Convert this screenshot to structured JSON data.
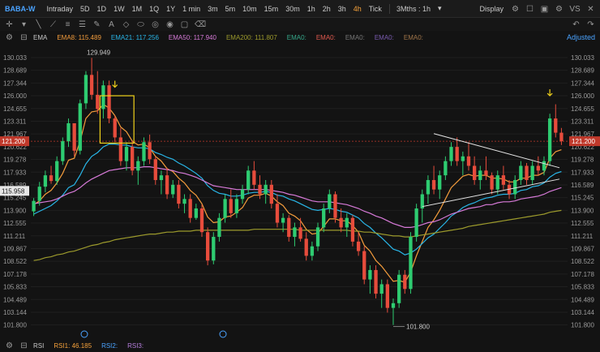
{
  "toolbar": {
    "symbol": "BABA-W",
    "timeframes": [
      "Intraday",
      "5D",
      "1D",
      "1W",
      "1M",
      "1Q",
      "1Y",
      "1 min",
      "3m",
      "5m",
      "10m",
      "15m",
      "30m",
      "1h",
      "2h",
      "3h",
      "4h",
      "Tick"
    ],
    "active_timeframe": "4h",
    "range": "3Mths : 1h",
    "display": "Display",
    "right_label": "VS"
  },
  "indicators": {
    "type": "EMA",
    "items": [
      {
        "label": "EMA8:",
        "value": "115.489",
        "color": "#f39c3c"
      },
      {
        "label": "EMA21:",
        "value": "117.256",
        "color": "#29b6e8"
      },
      {
        "label": "EMA50:",
        "value": "117.940",
        "color": "#d77ad8"
      },
      {
        "label": "EMA200:",
        "value": "111.807",
        "color": "#9c9a2c"
      },
      {
        "label": "EMA0:",
        "value": "",
        "color": "#36a88a"
      },
      {
        "label": "EMA0:",
        "value": "",
        "color": "#e25a4f"
      },
      {
        "label": "EMA0:",
        "value": "",
        "color": "#777777"
      },
      {
        "label": "EMA0:",
        "value": "",
        "color": "#7a5bb0"
      },
      {
        "label": "EMA0:",
        "value": "",
        "color": "#a0754a"
      }
    ],
    "adjusted": "Adjusted"
  },
  "rsi": {
    "type": "RSI",
    "items": [
      {
        "label": "RSI1:",
        "value": "46.185",
        "color": "#f6a23b"
      },
      {
        "label": "RSI2:",
        "value": "",
        "color": "#4aa3ff"
      },
      {
        "label": "RSI3:",
        "value": "",
        "color": "#b57edc"
      }
    ]
  },
  "chart_data": {
    "type": "line",
    "title": "",
    "y_ticks": [
      "130.033",
      "128.689",
      "127.344",
      "126.000",
      "124.655",
      "123.311",
      "121.967",
      "120.622",
      "119.278",
      "117.933",
      "116.589",
      "115.245",
      "113.900",
      "112.555",
      "111.211",
      "109.867",
      "108.522",
      "107.178",
      "105.833",
      "104.489",
      "103.144",
      "101.800"
    ],
    "ylim": [
      101.0,
      130.8
    ],
    "current_price": "121.200",
    "last_close_label": "115.958",
    "annotations": [
      {
        "text": "129.949",
        "type": "high"
      },
      {
        "text": "101.800",
        "type": "low"
      }
    ],
    "candles": [
      [
        113.8,
        115.2,
        113.3,
        114.9
      ],
      [
        114.9,
        116.9,
        114.4,
        116.4
      ],
      [
        116.4,
        118.1,
        115.8,
        117.6
      ],
      [
        117.6,
        118.6,
        116.7,
        117.0
      ],
      [
        117.0,
        119.6,
        116.6,
        119.1
      ],
      [
        119.1,
        121.6,
        118.7,
        121.2
      ],
      [
        121.2,
        123.6,
        120.6,
        123.1
      ],
      [
        123.1,
        122.8,
        119.6,
        120.2
      ],
      [
        120.2,
        125.6,
        119.8,
        125.2
      ],
      [
        125.2,
        128.6,
        124.6,
        128.2
      ],
      [
        128.2,
        130.0,
        125.6,
        126.1
      ],
      [
        126.1,
        128.6,
        124.1,
        124.6
      ],
      [
        124.6,
        127.6,
        123.6,
        127.1
      ],
      [
        127.1,
        127.6,
        123.1,
        123.6
      ],
      [
        123.6,
        123.9,
        121.1,
        121.6
      ],
      [
        121.6,
        122.6,
        118.6,
        119.1
      ],
      [
        119.1,
        121.1,
        118.1,
        120.6
      ],
      [
        120.6,
        121.2,
        117.6,
        118.1
      ],
      [
        118.1,
        119.6,
        116.6,
        119.1
      ],
      [
        119.1,
        121.6,
        118.6,
        121.1
      ],
      [
        121.1,
        121.9,
        118.8,
        119.3
      ],
      [
        119.3,
        119.6,
        116.6,
        117.1
      ],
      [
        117.1,
        118.1,
        115.6,
        117.6
      ],
      [
        117.6,
        118.4,
        115.1,
        115.6
      ],
      [
        115.6,
        117.1,
        115.2,
        116.6
      ],
      [
        116.6,
        117.1,
        114.1,
        114.6
      ],
      [
        114.6,
        115.6,
        113.6,
        115.1
      ],
      [
        115.1,
        115.6,
        112.6,
        113.1
      ],
      [
        113.1,
        114.6,
        112.9,
        114.1
      ],
      [
        114.1,
        114.5,
        111.1,
        111.6
      ],
      [
        111.6,
        112.1,
        108.1,
        108.6
      ],
      [
        108.6,
        111.6,
        108.2,
        111.1
      ],
      [
        111.1,
        113.6,
        110.6,
        113.1
      ],
      [
        113.1,
        115.6,
        112.6,
        115.1
      ],
      [
        115.1,
        116.1,
        113.1,
        113.6
      ],
      [
        113.6,
        115.6,
        113.1,
        115.1
      ],
      [
        115.1,
        116.6,
        114.6,
        116.1
      ],
      [
        116.1,
        118.6,
        115.6,
        118.1
      ],
      [
        118.1,
        119.1,
        116.1,
        116.6
      ],
      [
        116.6,
        117.6,
        115.1,
        115.6
      ],
      [
        115.6,
        117.1,
        114.6,
        116.6
      ],
      [
        116.6,
        117.1,
        114.1,
        114.6
      ],
      [
        114.6,
        115.6,
        112.1,
        112.6
      ],
      [
        112.6,
        113.6,
        111.6,
        113.1
      ],
      [
        113.1,
        113.4,
        110.6,
        111.1
      ],
      [
        111.1,
        112.6,
        110.1,
        112.1
      ],
      [
        112.1,
        113.1,
        110.6,
        110.9
      ],
      [
        110.9,
        111.6,
        108.6,
        109.1
      ],
      [
        109.1,
        110.6,
        108.6,
        110.1
      ],
      [
        110.1,
        112.6,
        109.6,
        112.1
      ],
      [
        112.1,
        114.6,
        111.6,
        114.1
      ],
      [
        114.1,
        116.1,
        113.6,
        115.6
      ],
      [
        115.6,
        115.9,
        112.6,
        113.1
      ],
      [
        113.1,
        114.1,
        111.6,
        112.1
      ],
      [
        112.1,
        113.6,
        111.1,
        113.1
      ],
      [
        113.1,
        113.4,
        110.1,
        110.6
      ],
      [
        110.6,
        111.6,
        109.1,
        109.6
      ],
      [
        109.6,
        110.1,
        106.1,
        106.6
      ],
      [
        106.6,
        108.1,
        105.1,
        107.6
      ],
      [
        107.6,
        108.1,
        104.6,
        105.1
      ],
      [
        105.1,
        106.6,
        103.6,
        106.1
      ],
      [
        106.1,
        106.6,
        103.1,
        103.6
      ],
      [
        103.6,
        104.6,
        101.8,
        104.1
      ],
      [
        104.1,
        107.6,
        103.6,
        107.1
      ],
      [
        107.1,
        107.6,
        105.1,
        105.6
      ],
      [
        105.6,
        111.6,
        105.1,
        111.1
      ],
      [
        111.1,
        114.6,
        110.6,
        114.1
      ],
      [
        114.1,
        116.1,
        112.6,
        115.6
      ],
      [
        115.6,
        117.6,
        114.6,
        117.1
      ],
      [
        117.1,
        118.6,
        115.6,
        116.1
      ],
      [
        116.1,
        118.1,
        115.1,
        117.6
      ],
      [
        117.6,
        119.6,
        117.1,
        119.1
      ],
      [
        119.1,
        121.1,
        118.6,
        120.6
      ],
      [
        120.6,
        121.6,
        118.6,
        119.1
      ],
      [
        119.1,
        120.1,
        117.6,
        119.6
      ],
      [
        119.6,
        121.1,
        118.1,
        118.6
      ],
      [
        118.6,
        119.6,
        116.6,
        117.1
      ],
      [
        117.1,
        118.6,
        116.1,
        118.1
      ],
      [
        118.1,
        119.6,
        117.1,
        117.6
      ],
      [
        117.6,
        117.9,
        115.6,
        116.1
      ],
      [
        116.1,
        118.1,
        115.6,
        117.6
      ],
      [
        117.6,
        118.6,
        116.1,
        116.6
      ],
      [
        116.6,
        117.1,
        115.1,
        115.6
      ],
      [
        115.6,
        117.6,
        115.1,
        117.1
      ],
      [
        117.1,
        119.1,
        116.6,
        118.6
      ],
      [
        118.6,
        118.9,
        116.6,
        117.1
      ],
      [
        117.1,
        119.1,
        116.6,
        118.6
      ],
      [
        118.6,
        119.6,
        117.6,
        118.1
      ],
      [
        118.1,
        119.6,
        117.6,
        119.1
      ],
      [
        119.1,
        124.1,
        118.6,
        123.6
      ],
      [
        123.6,
        125.1,
        121.6,
        122.1
      ],
      [
        122.1,
        122.6,
        120.8,
        121.2
      ]
    ],
    "series": [
      {
        "name": "EMA8",
        "color": "#f39c3c",
        "values": [
          114.5,
          114.9,
          115.6,
          116.0,
          116.8,
          117.8,
          119.2,
          119.4,
          121.2,
          123.6,
          124.3,
          124.4,
          125.1,
          124.7,
          123.9,
          122.7,
          122.2,
          121.2,
          120.8,
          120.9,
          120.5,
          119.6,
          119.1,
          118.3,
          118.0,
          117.3,
          116.8,
          116.0,
          115.5,
          114.6,
          113.2,
          112.6,
          112.7,
          113.2,
          113.3,
          113.7,
          114.2,
          115.2,
          115.5,
          115.5,
          115.7,
          115.4,
          114.8,
          114.4,
          113.6,
          113.3,
          112.8,
          111.9,
          111.4,
          111.5,
          112.2,
          113.0,
          113.0,
          112.8,
          112.8,
          112.3,
          111.6,
          110.2,
          109.6,
          108.6,
          108.0,
          107.2,
          106.4,
          106.5,
          106.3,
          107.4,
          109.1,
          110.6,
          112.1,
          112.9,
          113.9,
          115.1,
          116.3,
          116.9,
          117.5,
          117.7,
          117.5,
          117.6,
          117.6,
          117.3,
          117.3,
          117.2,
          116.9,
          116.9,
          117.3,
          117.3,
          117.6,
          117.6,
          117.9,
          119.4,
          120.1,
          120.3
        ]
      },
      {
        "name": "EMA21",
        "color": "#29b6e8",
        "values": [
          113.5,
          113.8,
          114.1,
          114.4,
          114.9,
          115.5,
          116.3,
          116.6,
          117.6,
          118.8,
          119.6,
          120.0,
          120.6,
          120.9,
          120.9,
          120.8,
          120.8,
          120.6,
          120.5,
          120.5,
          120.4,
          120.0,
          119.8,
          119.5,
          119.3,
          118.9,
          118.6,
          118.2,
          117.8,
          117.3,
          116.5,
          116.0,
          115.7,
          115.6,
          115.4,
          115.4,
          115.5,
          115.7,
          115.8,
          115.8,
          115.9,
          115.8,
          115.5,
          115.4,
          115.1,
          114.9,
          114.6,
          114.3,
          114.0,
          113.9,
          114.0,
          114.1,
          114.0,
          113.8,
          113.7,
          113.4,
          113.1,
          112.5,
          112.1,
          111.5,
          111.0,
          110.4,
          109.8,
          109.6,
          109.2,
          109.4,
          109.8,
          110.4,
          111.0,
          111.4,
          112.0,
          112.6,
          113.3,
          113.7,
          114.2,
          114.5,
          114.7,
          115.0,
          115.2,
          115.3,
          115.5,
          115.6,
          115.6,
          115.7,
          116.0,
          116.1,
          116.4,
          116.5,
          116.8,
          117.4,
          117.8,
          118.0
        ]
      },
      {
        "name": "EMA50",
        "color": "#d77ad8",
        "values": [
          114.6,
          114.7,
          114.8,
          114.9,
          115.1,
          115.4,
          115.7,
          115.9,
          116.3,
          116.8,
          117.2,
          117.5,
          117.8,
          118.1,
          118.2,
          118.3,
          118.4,
          118.4,
          118.4,
          118.5,
          118.5,
          118.4,
          118.3,
          118.2,
          118.1,
          117.9,
          117.8,
          117.6,
          117.4,
          117.1,
          116.8,
          116.5,
          116.4,
          116.3,
          116.2,
          116.1,
          116.1,
          116.1,
          116.1,
          116.1,
          116.1,
          116.0,
          115.9,
          115.8,
          115.6,
          115.5,
          115.3,
          115.1,
          114.9,
          114.8,
          114.8,
          114.8,
          114.7,
          114.6,
          114.5,
          114.3,
          114.1,
          113.8,
          113.6,
          113.3,
          113.1,
          112.8,
          112.5,
          112.3,
          112.1,
          112.1,
          112.2,
          112.4,
          112.6,
          112.7,
          112.9,
          113.2,
          113.5,
          113.7,
          113.9,
          114.1,
          114.2,
          114.3,
          114.5,
          114.5,
          114.7,
          114.8,
          114.8,
          114.9,
          115.1,
          115.2,
          115.3,
          115.4,
          115.6,
          115.9,
          116.1,
          116.3
        ]
      },
      {
        "name": "EMA200",
        "color": "#9c9a2c",
        "values": [
          108.6,
          108.7,
          108.9,
          109.0,
          109.2,
          109.3,
          109.5,
          109.6,
          109.8,
          110.0,
          110.2,
          110.3,
          110.5,
          110.6,
          110.8,
          110.9,
          111.0,
          111.1,
          111.2,
          111.3,
          111.4,
          111.4,
          111.5,
          111.6,
          111.6,
          111.7,
          111.7,
          111.7,
          111.8,
          111.8,
          111.8,
          111.8,
          111.8,
          111.8,
          111.8,
          111.8,
          111.8,
          111.8,
          111.9,
          111.9,
          111.9,
          111.9,
          111.9,
          111.9,
          111.9,
          111.9,
          111.8,
          111.8,
          111.8,
          111.8,
          111.8,
          111.8,
          111.8,
          111.8,
          111.8,
          111.7,
          111.7,
          111.6,
          111.6,
          111.5,
          111.4,
          111.3,
          111.2,
          111.2,
          111.1,
          111.1,
          111.2,
          111.3,
          111.4,
          111.5,
          111.6,
          111.7,
          111.8,
          111.9,
          112.0,
          112.2,
          112.3,
          112.4,
          112.5,
          112.6,
          112.7,
          112.8,
          112.9,
          113.0,
          113.1,
          113.2,
          113.3,
          113.4,
          113.5,
          113.7,
          113.8,
          113.9
        ]
      }
    ]
  }
}
